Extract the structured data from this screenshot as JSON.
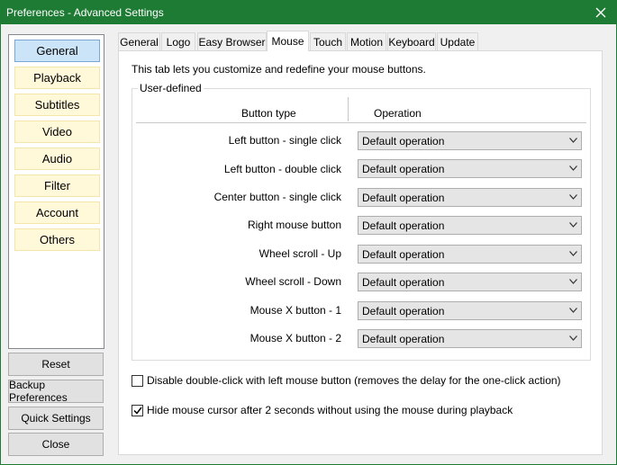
{
  "window": {
    "title": "Preferences - Advanced Settings"
  },
  "sidebar": {
    "items": [
      {
        "label": "General",
        "active": true
      },
      {
        "label": "Playback"
      },
      {
        "label": "Subtitles"
      },
      {
        "label": "Video"
      },
      {
        "label": "Audio"
      },
      {
        "label": "Filter"
      },
      {
        "label": "Account"
      },
      {
        "label": "Others"
      }
    ],
    "buttons": [
      "Reset",
      "Backup Preferences",
      "Quick Settings",
      "Close"
    ]
  },
  "tabs": [
    "General",
    "Logo",
    "Easy Browser",
    "Mouse",
    "Touch",
    "Motion",
    "Keyboard",
    "Update"
  ],
  "active_tab": "Mouse",
  "mouse": {
    "description": "This tab lets you customize and redefine your mouse buttons.",
    "group_label": "User-defined",
    "col_button_type": "Button type",
    "col_operation": "Operation",
    "rows": [
      {
        "label": "Left button - single click",
        "value": "Default operation"
      },
      {
        "label": "Left button - double click",
        "value": "Default operation"
      },
      {
        "label": "Center button - single click",
        "value": "Default operation"
      },
      {
        "label": "Right mouse button",
        "value": "Default operation"
      },
      {
        "label": "Wheel scroll - Up",
        "value": "Default operation"
      },
      {
        "label": "Wheel scroll - Down",
        "value": "Default operation"
      },
      {
        "label": "Mouse X button - 1",
        "value": "Default operation"
      },
      {
        "label": "Mouse X button - 2",
        "value": "Default operation"
      }
    ],
    "options": [
      {
        "label": "Disable double-click with left mouse button (removes the delay for the one-click action)",
        "checked": false
      },
      {
        "label": "Hide mouse cursor after 2 seconds without using the mouse during playback",
        "checked": true
      }
    ]
  },
  "colors": {
    "titlebar": "#1e7b34",
    "nav_item_bg": "#fff8d9",
    "nav_active_bg": "#cce4f7"
  }
}
